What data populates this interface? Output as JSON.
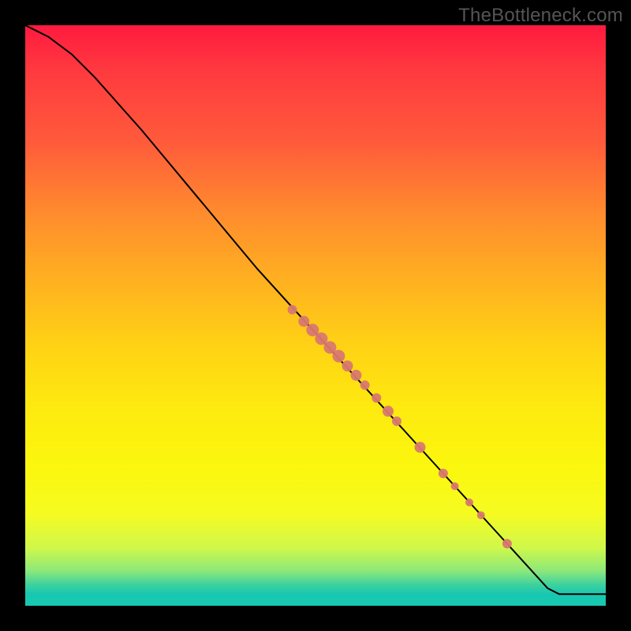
{
  "watermark": "TheBottleneck.com",
  "colors": {
    "page_bg": "#000000",
    "curve": "#000000",
    "dot": "#d9786f",
    "gradient_top": "#ff1a3f",
    "gradient_mid": "#ffd414",
    "gradient_bottom": "#17c8b2"
  },
  "chart_data": {
    "type": "line",
    "title": "",
    "xlabel": "",
    "ylabel": "",
    "xlim": [
      0,
      100
    ],
    "ylim": [
      0,
      100
    ],
    "curve": [
      {
        "x": 0,
        "y": 100
      },
      {
        "x": 4,
        "y": 98
      },
      {
        "x": 8,
        "y": 95
      },
      {
        "x": 12,
        "y": 91
      },
      {
        "x": 16,
        "y": 86.5
      },
      {
        "x": 20,
        "y": 82
      },
      {
        "x": 25,
        "y": 76
      },
      {
        "x": 30,
        "y": 70
      },
      {
        "x": 35,
        "y": 64
      },
      {
        "x": 40,
        "y": 58
      },
      {
        "x": 45,
        "y": 52.5
      },
      {
        "x": 50,
        "y": 47
      },
      {
        "x": 55,
        "y": 41.5
      },
      {
        "x": 60,
        "y": 36
      },
      {
        "x": 65,
        "y": 30.5
      },
      {
        "x": 70,
        "y": 25
      },
      {
        "x": 75,
        "y": 19.5
      },
      {
        "x": 80,
        "y": 14
      },
      {
        "x": 85,
        "y": 8.5
      },
      {
        "x": 90,
        "y": 3
      },
      {
        "x": 92,
        "y": 2
      },
      {
        "x": 100,
        "y": 2
      }
    ],
    "points": [
      {
        "x": 46,
        "y": 51,
        "r": 6
      },
      {
        "x": 48,
        "y": 49,
        "r": 7
      },
      {
        "x": 49.5,
        "y": 47.5,
        "r": 8
      },
      {
        "x": 51,
        "y": 46,
        "r": 8
      },
      {
        "x": 52.5,
        "y": 44.5,
        "r": 8
      },
      {
        "x": 54,
        "y": 43,
        "r": 8
      },
      {
        "x": 55.5,
        "y": 41.3,
        "r": 7
      },
      {
        "x": 57,
        "y": 39.7,
        "r": 7
      },
      {
        "x": 58.5,
        "y": 38,
        "r": 6
      },
      {
        "x": 60.5,
        "y": 35.8,
        "r": 6
      },
      {
        "x": 62.5,
        "y": 33.5,
        "r": 7
      },
      {
        "x": 64,
        "y": 31.8,
        "r": 6
      },
      {
        "x": 68,
        "y": 27.3,
        "r": 7
      },
      {
        "x": 72,
        "y": 22.8,
        "r": 6
      },
      {
        "x": 74,
        "y": 20.6,
        "r": 5
      },
      {
        "x": 76.5,
        "y": 17.8,
        "r": 5
      },
      {
        "x": 78.5,
        "y": 15.6,
        "r": 5
      },
      {
        "x": 83,
        "y": 10.7,
        "r": 6
      }
    ]
  }
}
